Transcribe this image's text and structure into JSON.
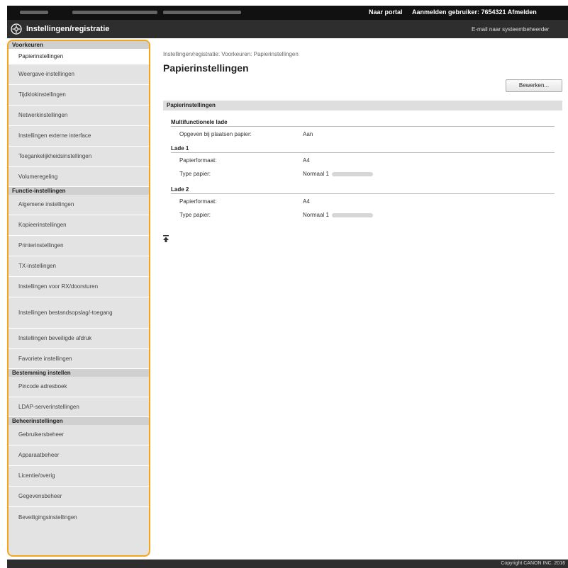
{
  "topbar": {
    "portal_label": "Naar portal",
    "login_label": "Aanmelden gebruiker:  7654321  Afmelden"
  },
  "header": {
    "title": "Instellingen/registratie",
    "mail_link": "E-mail naar systeembeheerder"
  },
  "sidebar": {
    "sections": [
      {
        "label": "Voorkeuren",
        "items": [
          {
            "label": "Papierinstellingen",
            "active": true
          },
          {
            "label": "Weergave-instellingen"
          },
          {
            "label": "Tijdklokinstellingen"
          },
          {
            "label": "Netwerkinstellingen"
          },
          {
            "label": "Instellingen externe interface"
          },
          {
            "label": "Toegankelijkheidsinstellingen"
          },
          {
            "label": "Volumeregeling"
          }
        ]
      },
      {
        "label": "Functie-instellingen",
        "items": [
          {
            "label": "Algemene instellingen"
          },
          {
            "label": "Kopieerinstellingen"
          },
          {
            "label": "Printerinstellingen"
          },
          {
            "label": "TX-instellingen"
          },
          {
            "label": "Instellingen voor RX/doorsturen"
          },
          {
            "label": "Instellingen bestandsopslag/-toegang"
          },
          {
            "label": "Instellingen beveiligde afdruk"
          },
          {
            "label": "Favoriete instellingen"
          }
        ]
      },
      {
        "label": "Bestemming instellen",
        "items": [
          {
            "label": "Pincode adresboek"
          },
          {
            "label": "LDAP-serverinstellingen"
          }
        ]
      },
      {
        "label": "Beheerinstellingen",
        "items": [
          {
            "label": "Gebruikersbeheer"
          },
          {
            "label": "Apparaatbeheer"
          },
          {
            "label": "Licentie/overig"
          },
          {
            "label": "Gegevensbeheer"
          },
          {
            "label": "Beveiligingsinstellingen"
          }
        ]
      }
    ]
  },
  "main": {
    "breadcrumb": "Instellingen/registratie: Voorkeuren: Papierinstellingen",
    "title": "Papierinstellingen",
    "edit_button": "Bewerken...",
    "section_title": "Papierinstellingen",
    "groups": {
      "mf": {
        "title": "Multifunctionele lade",
        "rows": [
          {
            "label": "Opgeven bij plaatsen papier:",
            "value": "Aan"
          }
        ]
      },
      "lade1": {
        "title": "Lade 1",
        "rows": [
          {
            "label": "Papierformaat:",
            "value": "A4"
          },
          {
            "label": "Type papier:",
            "value": "Normaal 1"
          }
        ]
      },
      "lade2": {
        "title": "Lade 2",
        "rows": [
          {
            "label": "Papierformaat:",
            "value": "A4"
          },
          {
            "label": "Type papier:",
            "value": "Normaal 1"
          }
        ]
      }
    }
  },
  "footer": {
    "copyright": "Copyright CANON INC. 2016"
  },
  "colors": {
    "highlight": "#f4a51c",
    "header_bg": "#2e2e2e",
    "topbar_bg": "#111111"
  }
}
